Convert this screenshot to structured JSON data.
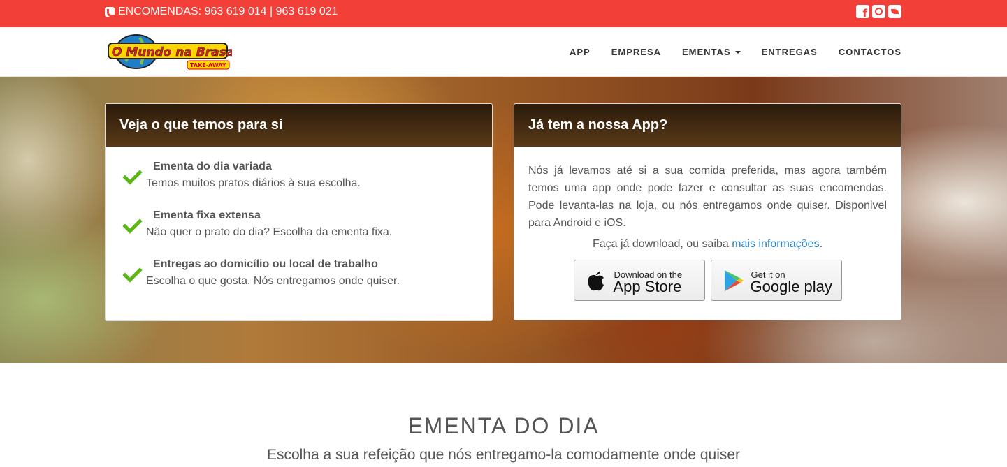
{
  "topbar": {
    "phone_text": "ENCOMENDAS: 963 619 014 | 963 619 021",
    "social_icons": [
      "facebook-icon",
      "instagram-icon",
      "twitter-icon"
    ],
    "color": "#f23f37"
  },
  "logo": {
    "main_text": "O Mundo na Brasa",
    "tag": "TAKE-AWAY"
  },
  "nav": {
    "items": [
      {
        "label": "APP"
      },
      {
        "label": "EMPRESA"
      },
      {
        "label": "EMENTAS"
      },
      {
        "label": "ENTREGAS"
      },
      {
        "label": "CONTACTOS"
      }
    ]
  },
  "panel_left": {
    "title": "Veja o que temos para si",
    "features": [
      {
        "title": "Ementa do dia variada",
        "desc": "Temos muitos pratos diários à sua escolha."
      },
      {
        "title": "Ementa fixa extensa",
        "desc": "Não quer o prato do dia? Escolha da ementa fixa."
      },
      {
        "title": "Entregas ao domicílio ou local de trabalho",
        "desc": "Escolha o que gosta. Nós entregamos onde quiser."
      }
    ]
  },
  "panel_right": {
    "title": "Já tem a nossa App?",
    "body": "Nós já levamos até si a sua comida preferida, mas agora também temos uma app onde pode fazer e consultar as suas encomendas. Pode levanta-las na loja, ou nós entregamos onde quiser. Disponivel para Android e iOS.",
    "download_text": "Faça já download, ou saiba ",
    "link_text": "mais informações",
    "link_suffix": ".",
    "appstore": {
      "small": "Download on the",
      "big": "App Store"
    },
    "googleplay": {
      "small": "Get it on",
      "big": "Google play"
    }
  },
  "section": {
    "title": "EMENTA DO DIA",
    "subtitle": "Escolha a sua refeição que nós entregamo-la comodamente onde quiser"
  }
}
